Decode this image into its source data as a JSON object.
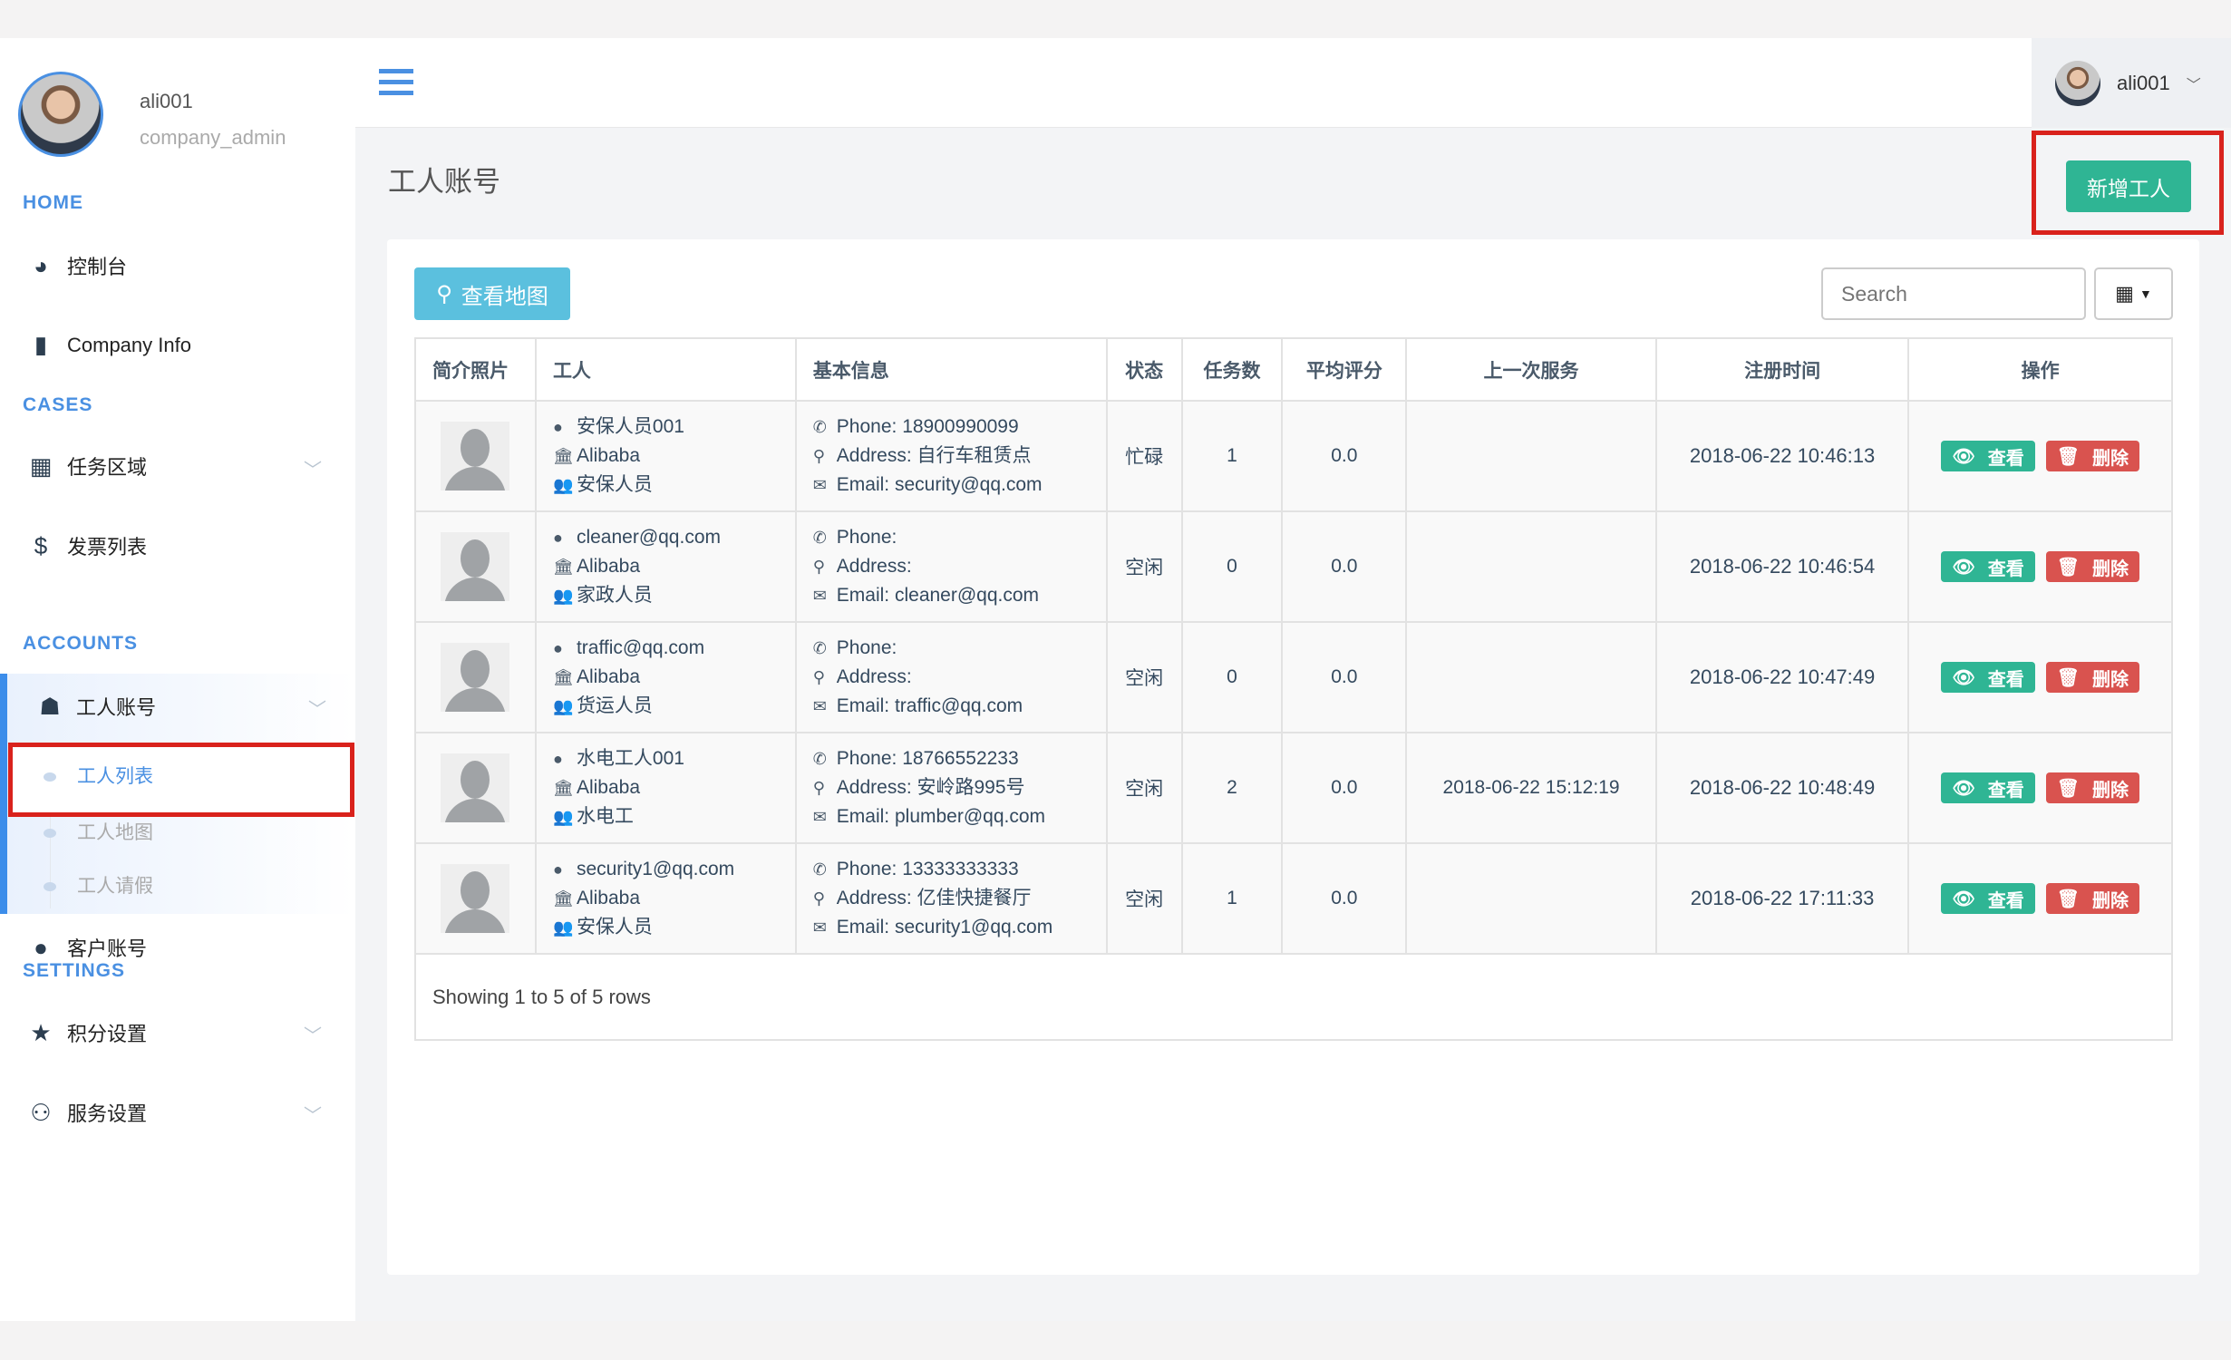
{
  "user": {
    "name": "ali001",
    "role": "company_admin"
  },
  "sidebar": {
    "sections": [
      "HOME",
      "CASES",
      "ACCOUNTS",
      "SETTINGS"
    ],
    "items": [
      "控制台",
      "Company Info",
      "任务区域",
      "发票列表",
      "工人账号",
      "客户账号",
      "积分设置",
      "服务设置"
    ],
    "sub": [
      "工人列表",
      "工人地图",
      "工人请假"
    ]
  },
  "header": {
    "user": "ali001"
  },
  "page": {
    "title": "工人账号",
    "new_button": "新增工人",
    "map_button": "查看地图",
    "search_placeholder": "Search",
    "footer": "Showing 1 to 5 of 5 rows"
  },
  "table": {
    "headers": [
      "简介照片",
      "工人",
      "基本信息",
      "状态",
      "任务数",
      "平均评分",
      "上一次服务",
      "注册时间",
      "操作"
    ],
    "view": "查看",
    "delete": "删除",
    "rows": [
      {
        "name": "安保人员001",
        "company": "Alibaba",
        "type": "安保人员",
        "phone": "Phone: 18900990099",
        "address": "Address: 自行车租赁点",
        "email": "Email: security@qq.com",
        "status": "忙碌",
        "tasks": "1",
        "rating": "0.0",
        "last": "",
        "registered": "2018-06-22 10:46:13"
      },
      {
        "name": "cleaner@qq.com",
        "company": "Alibaba",
        "type": "家政人员",
        "phone": "Phone:",
        "address": "Address:",
        "email": "Email: cleaner@qq.com",
        "status": "空闲",
        "tasks": "0",
        "rating": "0.0",
        "last": "",
        "registered": "2018-06-22 10:46:54"
      },
      {
        "name": "traffic@qq.com",
        "company": "Alibaba",
        "type": "货运人员",
        "phone": "Phone:",
        "address": "Address:",
        "email": "Email: traffic@qq.com",
        "status": "空闲",
        "tasks": "0",
        "rating": "0.0",
        "last": "",
        "registered": "2018-06-22 10:47:49"
      },
      {
        "name": "水电工人001",
        "company": "Alibaba",
        "type": "水电工",
        "phone": "Phone: 18766552233",
        "address": "Address: 安岭路995号",
        "email": "Email: plumber@qq.com",
        "status": "空闲",
        "tasks": "2",
        "rating": "0.0",
        "last": "2018-06-22 15:12:19",
        "registered": "2018-06-22 10:48:49"
      },
      {
        "name": "security1@qq.com",
        "company": "Alibaba",
        "type": "安保人员",
        "phone": "Phone: 13333333333",
        "address": "Address: 亿佳快捷餐厅",
        "email": "Email: security1@qq.com",
        "status": "空闲",
        "tasks": "1",
        "rating": "0.0",
        "last": "",
        "registered": "2018-06-22 17:11:33"
      }
    ]
  },
  "colors": {
    "accent": "#4a90e2",
    "success": "#2fb594",
    "danger": "#d9534f",
    "info": "#5bc0de",
    "highlight": "#d9221c"
  }
}
